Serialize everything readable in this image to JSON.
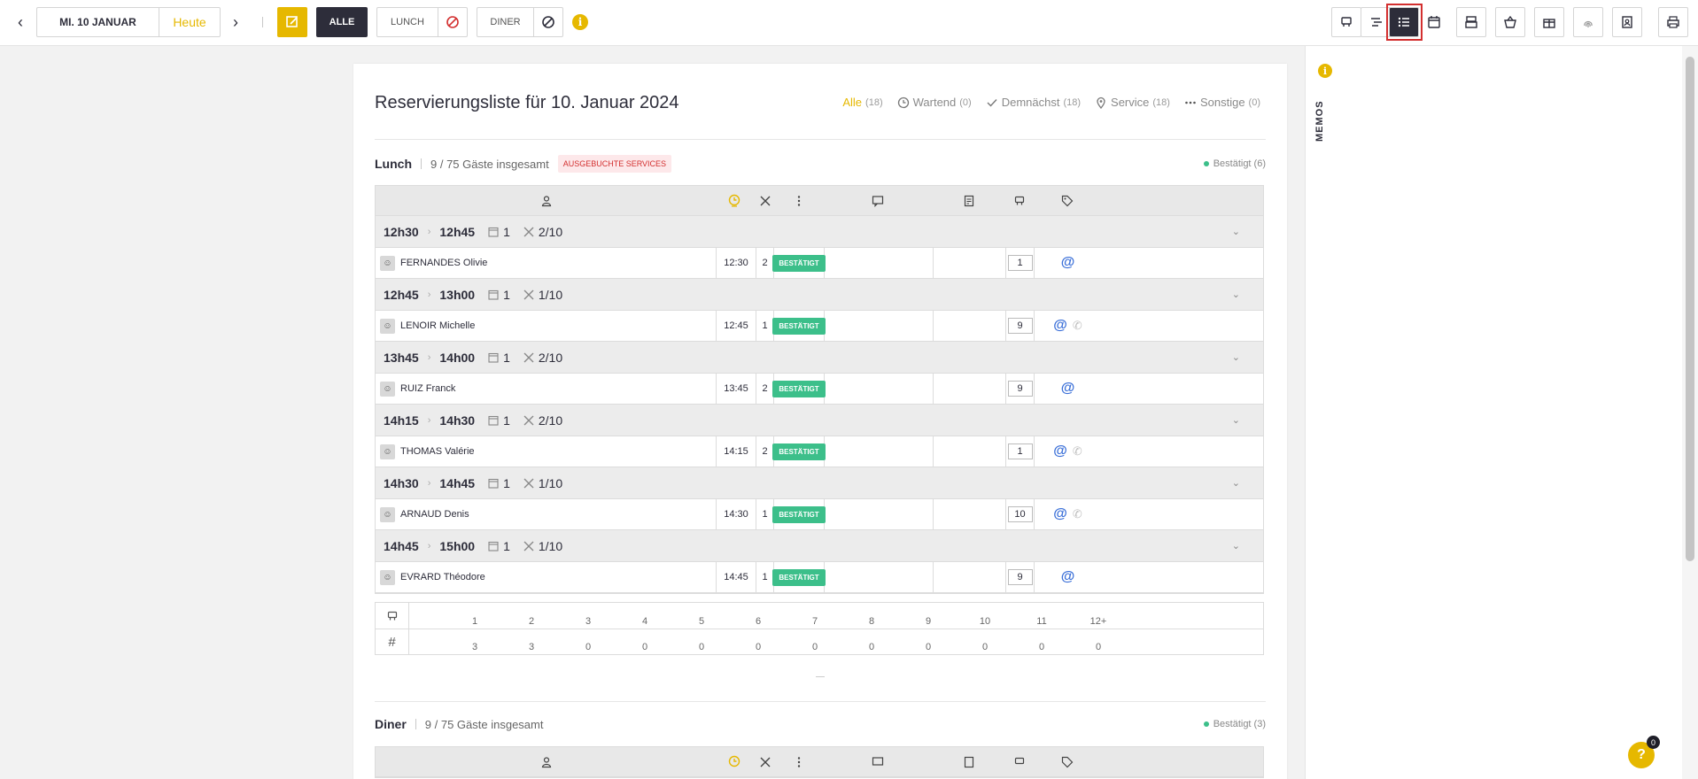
{
  "topbar": {
    "date_label": "MI. 10 JANUAR",
    "today_label": "Heute",
    "alle_label": "ALLE",
    "lunch_label": "LUNCH",
    "diner_label": "DINER"
  },
  "card": {
    "title": "Reservierungsliste für 10. Januar 2024",
    "filters": [
      {
        "name": "Alle",
        "count": "(18)"
      },
      {
        "name": "Wartend",
        "count": "(0)"
      },
      {
        "name": "Demnächst",
        "count": "(18)"
      },
      {
        "name": "Service",
        "count": "(18)"
      },
      {
        "name": "Sonstige",
        "count": "(0)"
      }
    ]
  },
  "lunch": {
    "name": "Lunch",
    "guests": "9 / 75 Gäste insgesamt",
    "badge": "AUSGEBUCHTE SERVICES",
    "confirmed": "Bestätigt (6)",
    "groups": [
      {
        "from": "12h30",
        "to": "12h45",
        "res": "1",
        "covers": "2/10",
        "guest": "FERNANDES Olivie",
        "time": "12:30",
        "pax": "2",
        "status": "BESTÄTIGT",
        "table": "1",
        "phone": false
      },
      {
        "from": "12h45",
        "to": "13h00",
        "res": "1",
        "covers": "1/10",
        "guest": "LENOIR Michelle",
        "time": "12:45",
        "pax": "1",
        "status": "BESTÄTIGT",
        "table": "9",
        "phone": true
      },
      {
        "from": "13h45",
        "to": "14h00",
        "res": "1",
        "covers": "2/10",
        "guest": "RUIZ Franck",
        "time": "13:45",
        "pax": "2",
        "status": "BESTÄTIGT",
        "table": "9",
        "phone": false
      },
      {
        "from": "14h15",
        "to": "14h30",
        "res": "1",
        "covers": "2/10",
        "guest": "THOMAS Valérie",
        "time": "14:15",
        "pax": "2",
        "status": "BESTÄTIGT",
        "table": "1",
        "phone": true
      },
      {
        "from": "14h30",
        "to": "14h45",
        "res": "1",
        "covers": "1/10",
        "guest": "ARNAUD Denis",
        "time": "14:30",
        "pax": "1",
        "status": "BESTÄTIGT",
        "table": "10",
        "phone": true
      },
      {
        "from": "14h45",
        "to": "15h00",
        "res": "1",
        "covers": "1/10",
        "guest": "EVRARD Théodore",
        "time": "14:45",
        "pax": "1",
        "status": "BESTÄTIGT",
        "table": "9",
        "phone": false
      }
    ],
    "summary": {
      "sizes": [
        "1",
        "2",
        "3",
        "4",
        "5",
        "6",
        "7",
        "8",
        "9",
        "10",
        "11",
        "12+"
      ],
      "counts": [
        "3",
        "3",
        "0",
        "0",
        "0",
        "0",
        "0",
        "0",
        "0",
        "0",
        "0",
        "0"
      ]
    },
    "summary_hash": "#"
  },
  "diner": {
    "name": "Diner",
    "guests": "9 / 75 Gäste insgesamt",
    "confirmed": "Bestätigt (3)"
  },
  "side": {
    "memos_label": "MEMOS"
  },
  "help": {
    "label": "?",
    "badge": "0"
  },
  "colors": {
    "accent": "#e6b800",
    "dark": "#2d2d3a",
    "confirmed": "#3cbf8a",
    "danger": "#d32f2f",
    "link": "#3a6fd8"
  }
}
